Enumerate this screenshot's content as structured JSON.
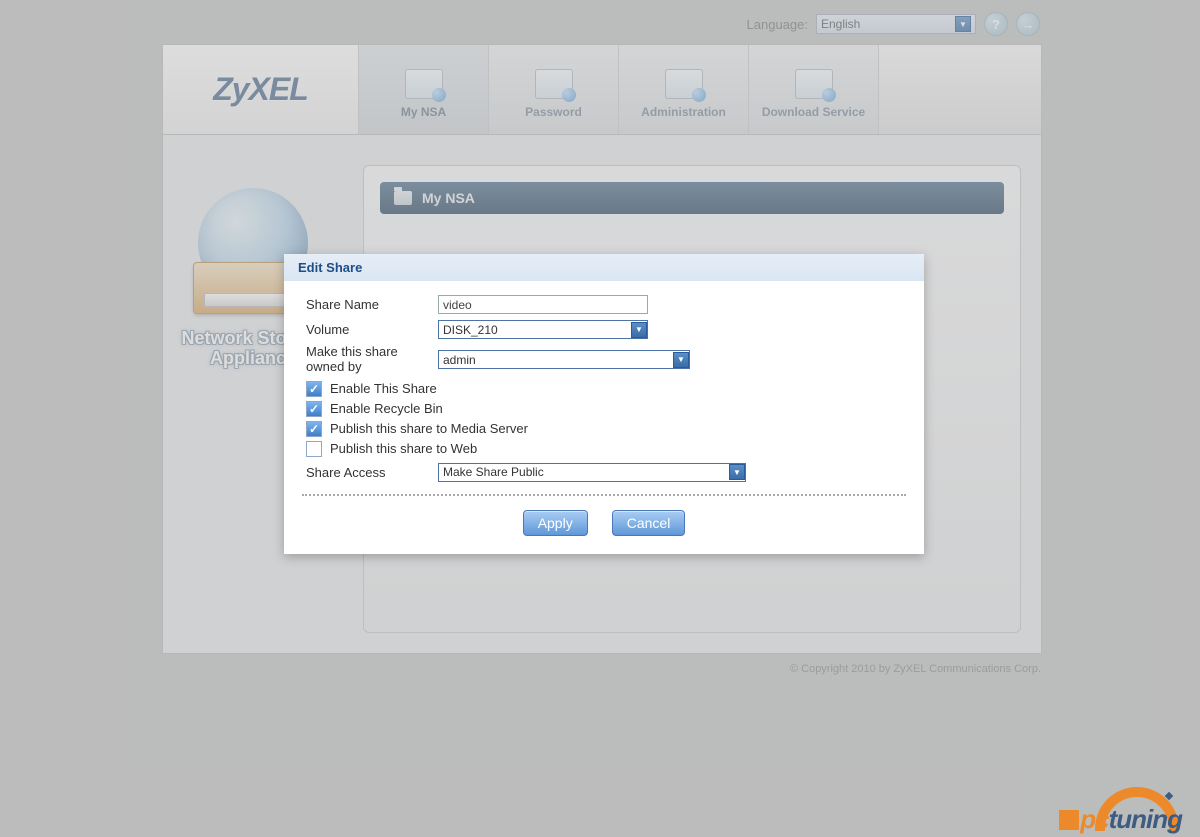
{
  "topbar": {
    "language_label": "Language:",
    "language_value": "English",
    "help_symbol": "?",
    "logout_symbol": "→"
  },
  "brand": {
    "name": "ZyXEL"
  },
  "nav": {
    "tabs": [
      {
        "label": "My NSA",
        "active": true
      },
      {
        "label": "Password",
        "active": false
      },
      {
        "label": "Administration",
        "active": false
      },
      {
        "label": "Download Service",
        "active": false
      }
    ]
  },
  "sidebar": {
    "appliance_label_line1": "Network Storage",
    "appliance_label_line2": "Appliance"
  },
  "section": {
    "title": "My NSA"
  },
  "modal": {
    "title": "Edit Share",
    "share_name_label": "Share Name",
    "share_name_value": "video",
    "volume_label": "Volume",
    "volume_value": "DISK_210",
    "owner_label": "Make this share owned by",
    "owner_value": "admin",
    "checks": {
      "enable_share": {
        "label": "Enable This Share",
        "checked": true
      },
      "enable_recycle": {
        "label": "Enable Recycle Bin",
        "checked": true
      },
      "publish_media": {
        "label": "Publish this share to Media Server",
        "checked": true
      },
      "publish_web": {
        "label": "Publish this share to Web",
        "checked": false
      }
    },
    "share_access_label": "Share Access",
    "share_access_value": "Make Share Public",
    "apply_label": "Apply",
    "cancel_label": "Cancel"
  },
  "footer": {
    "copyright": "© Copyright 2010 by ZyXEL Communications Corp."
  },
  "watermark": {
    "pc": "pc",
    "tuning": "tuning"
  }
}
